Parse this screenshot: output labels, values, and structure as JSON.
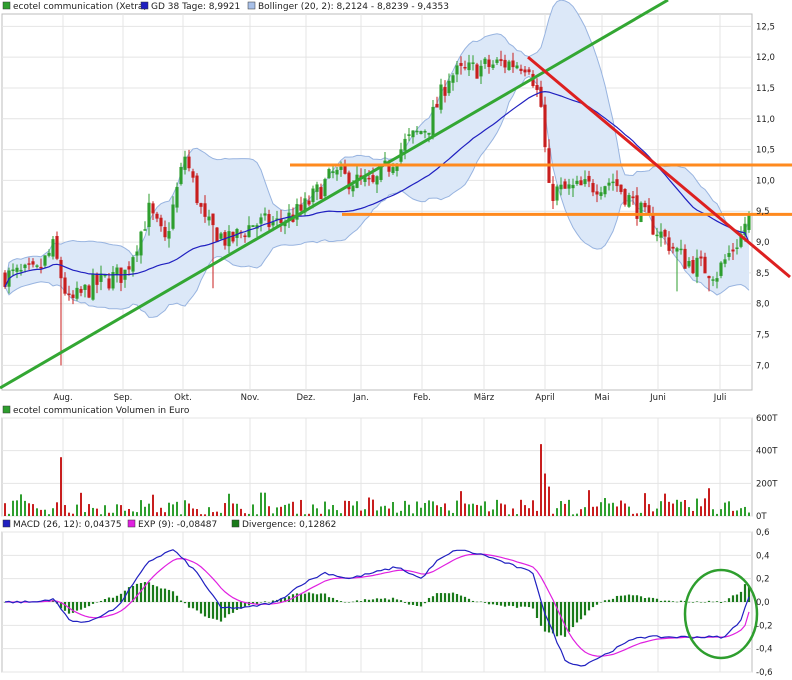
{
  "legend_top": [
    {
      "label": "ecotel communication (Xetra)",
      "color": "#2e9e2e"
    },
    {
      "label": "GD 38 Tage: 8,9921",
      "color": "#2020c0"
    },
    {
      "label": "Bollinger (20, 2): 8,2124 - 8,8239 - 9,4353",
      "color": "#a8c0e8"
    }
  ],
  "legend_volume": [
    {
      "label": "ecotel communication Volumen in Euro",
      "color": "#2e9e2e"
    }
  ],
  "legend_macd": [
    {
      "label": "MACD (26, 12): 0,04375",
      "color": "#2020c0"
    },
    {
      "label": "EXP (9): -0,08487",
      "color": "#e020e0"
    },
    {
      "label": "Divergence: 0,12862",
      "color": "#1a7a1a"
    }
  ],
  "colors": {
    "up": "#2e9e2e",
    "down": "#c81e1e",
    "gd": "#2020c0",
    "band_fill": "#dce8f8",
    "band_line": "#98b4e0",
    "trend_green": "#33a733",
    "trend_red": "#dd2020",
    "trend_orange": "#ff8a1e",
    "macd": "#2020c0",
    "exp": "#e020e0",
    "divergence": "#1a7a1a",
    "circle": "#2e9e2e"
  },
  "chart_data": [
    {
      "type": "candlestick",
      "name": "price",
      "months": [
        "Aug.",
        "Sep.",
        "Okt.",
        "Nov.",
        "Dez.",
        "Jan.",
        "Feb.",
        "März",
        "April",
        "Mai",
        "Juni",
        "Juli"
      ],
      "ylim": [
        6.6,
        12.7
      ],
      "yticks": [
        "12,5",
        "12,0",
        "11,5",
        "11,0",
        "10,5",
        "10,0",
        "9,5",
        "9,0",
        "8,5",
        "8,0",
        "7,5",
        "7,0"
      ],
      "ytick_values": [
        12.5,
        12.0,
        11.5,
        11.0,
        10.5,
        10.0,
        9.5,
        9.0,
        8.5,
        8.0,
        7.5,
        7.0
      ],
      "close_keypoints": [
        [
          0,
          8.45
        ],
        [
          8,
          8.5
        ],
        [
          12,
          8.9
        ],
        [
          16,
          8.0
        ],
        [
          22,
          8.3
        ],
        [
          30,
          8.5
        ],
        [
          36,
          9.5
        ],
        [
          40,
          9.0
        ],
        [
          45,
          10.4
        ],
        [
          50,
          9.3
        ],
        [
          56,
          9.0
        ],
        [
          62,
          9.3
        ],
        [
          68,
          9.3
        ],
        [
          74,
          9.5
        ],
        [
          82,
          10.1
        ],
        [
          92,
          9.9
        ],
        [
          100,
          10.6
        ],
        [
          106,
          10.9
        ],
        [
          111,
          11.7
        ],
        [
          117,
          11.8
        ],
        [
          124,
          11.9
        ],
        [
          131,
          11.9
        ],
        [
          134,
          11.2
        ],
        [
          136,
          9.8
        ],
        [
          146,
          9.9
        ],
        [
          152,
          10.0
        ],
        [
          160,
          9.4
        ],
        [
          170,
          8.7
        ],
        [
          178,
          8.5
        ],
        [
          184,
          9.1
        ],
        [
          186,
          9.5
        ]
      ],
      "low_spikes": [
        [
          14,
          7.0
        ],
        [
          52,
          8.25
        ],
        [
          168,
          8.2
        ],
        [
          176,
          8.2
        ]
      ],
      "gd38": {
        "label": "GD 38 Tage",
        "last": 8.9921
      },
      "bollinger": {
        "label": "Bollinger (20, 2)",
        "lower": 8.2124,
        "middle": 8.8239,
        "upper": 9.4353
      }
    },
    {
      "type": "bar",
      "name": "volume",
      "ylim": [
        0,
        600
      ],
      "yticks": [
        "600T",
        "400T",
        "200T",
        "0T"
      ],
      "ytick_values": [
        600,
        400,
        200,
        0
      ],
      "spikes": [
        [
          14,
          360
        ],
        [
          134,
          440
        ],
        [
          135,
          260
        ],
        [
          136,
          180
        ],
        [
          150,
          110
        ],
        [
          160,
          140
        ],
        [
          176,
          170
        ]
      ]
    },
    {
      "type": "line",
      "name": "macd",
      "ylim": [
        -0.6,
        0.6
      ],
      "yticks": [
        "0,6",
        "0,4",
        "0,2",
        "0,0",
        "-0,2",
        "-0,4",
        "-0,6"
      ],
      "ytick_values": [
        0.6,
        0.4,
        0.2,
        0.0,
        -0.2,
        -0.4,
        -0.6
      ],
      "macd_keypoints": [
        [
          0,
          0.0
        ],
        [
          8,
          0.0
        ],
        [
          12,
          0.03
        ],
        [
          16,
          -0.15
        ],
        [
          20,
          -0.18
        ],
        [
          28,
          -0.05
        ],
        [
          36,
          0.35
        ],
        [
          42,
          0.45
        ],
        [
          48,
          0.25
        ],
        [
          54,
          -0.05
        ],
        [
          60,
          -0.05
        ],
        [
          68,
          0.0
        ],
        [
          74,
          0.15
        ],
        [
          80,
          0.25
        ],
        [
          86,
          0.2
        ],
        [
          92,
          0.25
        ],
        [
          98,
          0.3
        ],
        [
          104,
          0.2
        ],
        [
          108,
          0.35
        ],
        [
          113,
          0.45
        ],
        [
          120,
          0.4
        ],
        [
          128,
          0.3
        ],
        [
          132,
          0.25
        ],
        [
          135,
          -0.1
        ],
        [
          140,
          -0.5
        ],
        [
          144,
          -0.55
        ],
        [
          150,
          -0.45
        ],
        [
          158,
          -0.3
        ],
        [
          165,
          -0.3
        ],
        [
          172,
          -0.3
        ],
        [
          180,
          -0.3
        ],
        [
          184,
          -0.15
        ],
        [
          186,
          0.04375
        ]
      ],
      "exp_last": -0.08487,
      "divergence_last": 0.12862
    }
  ]
}
